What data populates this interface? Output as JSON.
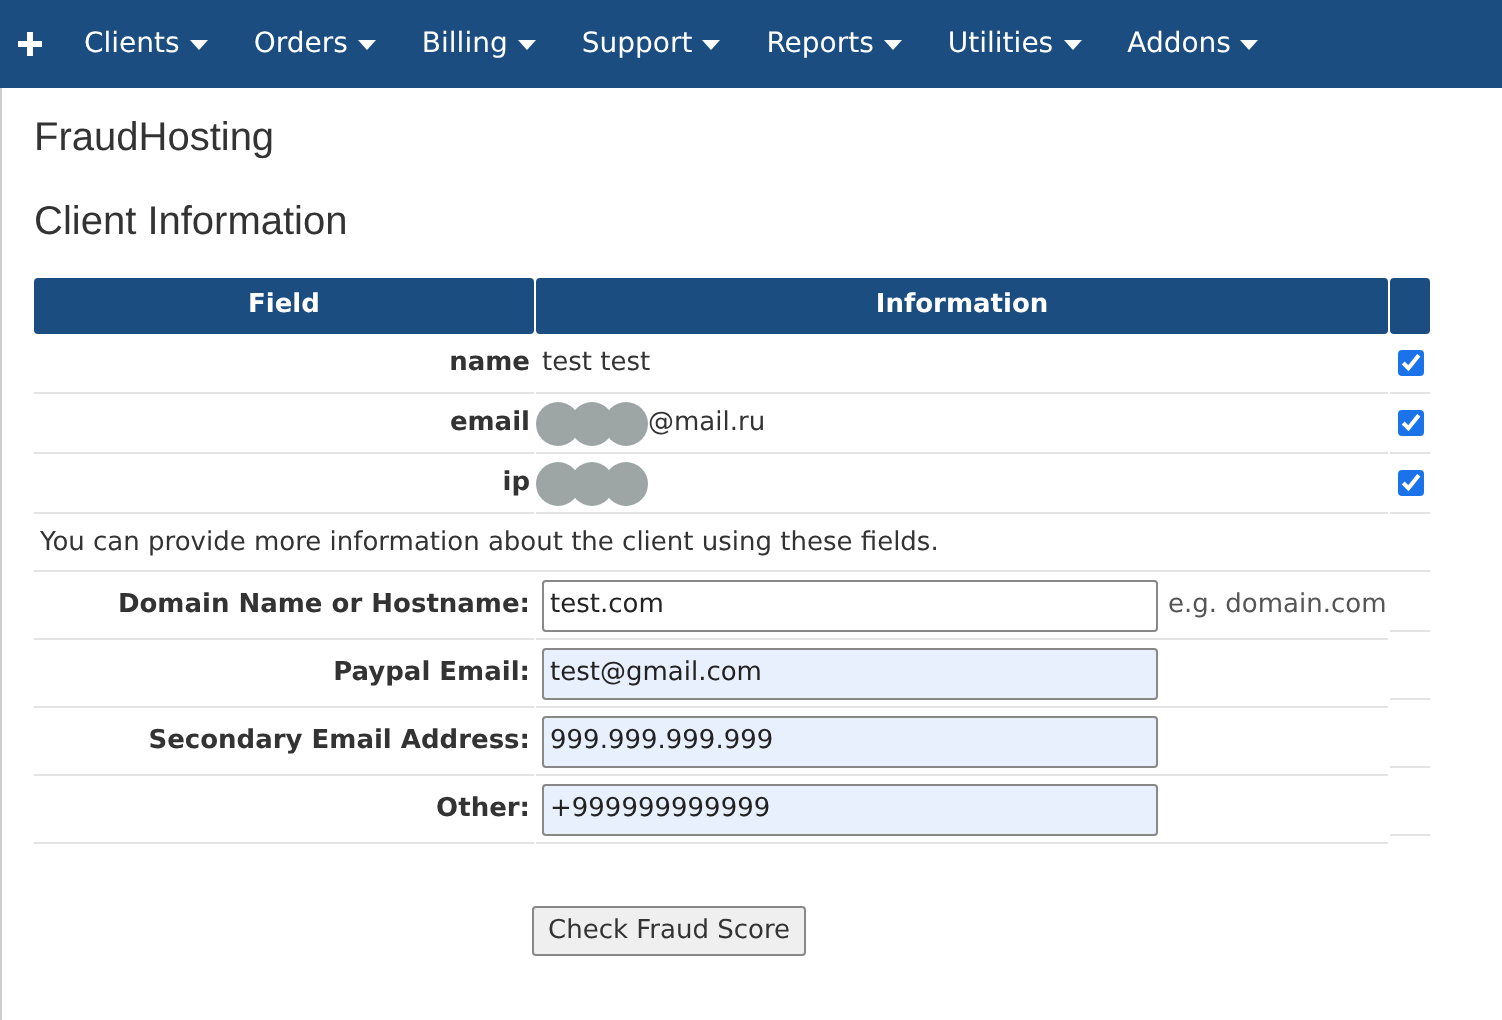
{
  "nav": {
    "menus": [
      {
        "label": "Clients"
      },
      {
        "label": "Orders"
      },
      {
        "label": "Billing"
      },
      {
        "label": "Support"
      },
      {
        "label": "Reports"
      },
      {
        "label": "Utilities"
      },
      {
        "label": "Addons"
      }
    ]
  },
  "site_title": "FraudHosting",
  "heading": "Client Information",
  "table": {
    "columns": [
      "Field",
      "Information"
    ],
    "rows": [
      {
        "field": "name",
        "value": "test test",
        "redacted": false,
        "checked": true
      },
      {
        "field": "email",
        "value": "@mail.ru",
        "redacted": true,
        "checked": true
      },
      {
        "field": "ip",
        "redacted": true,
        "checked": true
      }
    ]
  },
  "note": "You can provide more information about the client using these fields.",
  "form": [
    {
      "label": "Domain Name or Hostname:",
      "value": "test.com",
      "autofilled": false,
      "hint": "e.g. domain.com"
    },
    {
      "label": "Paypal Email:",
      "value": "test@gmail.com",
      "autofilled": true
    },
    {
      "label": "Secondary Email Address:",
      "value": "999.999.999.999",
      "autofilled": true
    },
    {
      "label": "Other:",
      "value": "+999999999999",
      "autofilled": true
    }
  ],
  "submit": "Check Fraud Score"
}
